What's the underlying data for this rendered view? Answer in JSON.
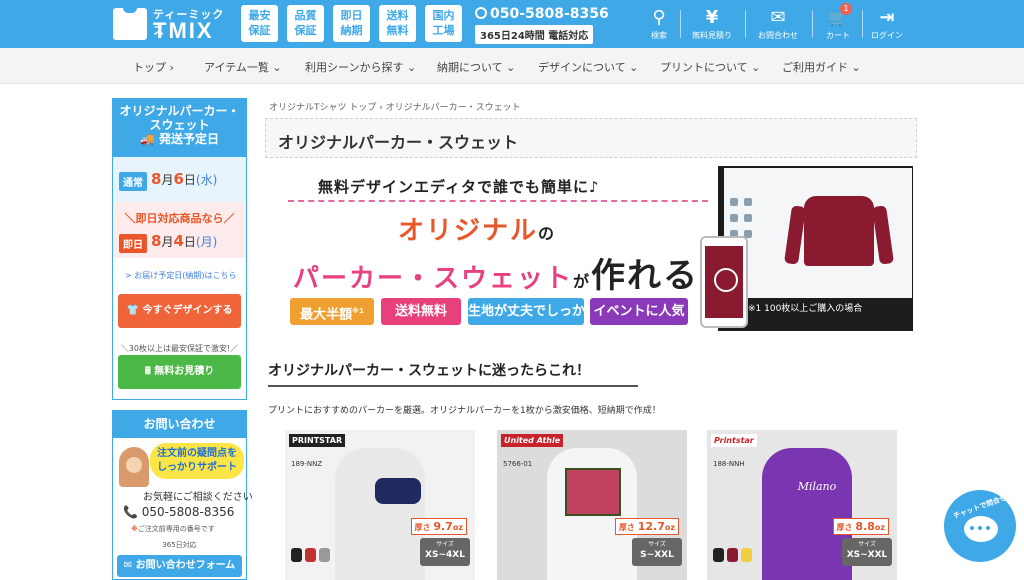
{
  "header": {
    "logo_kana": "ティーミックス",
    "logo_name": "TMIX",
    "features": [
      "最安\n保証",
      "品質\n保証",
      "即日\n納期",
      "送料\n無料",
      "国内\n工場"
    ],
    "phone": "050-5808-8356",
    "hours": "365日24時間 電話対応",
    "icons": [
      {
        "name": "search-icon",
        "glyph": "⚲",
        "label": "検索"
      },
      {
        "name": "yen-icon",
        "glyph": "¥",
        "label": "無料見積り"
      },
      {
        "name": "mail-icon",
        "glyph": "✉",
        "label": "お問合わせ"
      },
      {
        "name": "cart-icon",
        "glyph": "🛒",
        "label": "カート",
        "badge": "1"
      },
      {
        "name": "login-icon",
        "glyph": "⇥",
        "label": "ログイン"
      }
    ],
    "color": "#3fa9e8"
  },
  "nav": [
    "トップ ›",
    "アイテム一覧 ⌄",
    "利用シーンから探す ⌄",
    "納期について ⌄",
    "デザインについて ⌄",
    "プリントについて ⌄",
    "ご利用ガイド ⌄"
  ],
  "sidebar": {
    "ship_title": "オリジナルパーカー・スウェット",
    "ship_sub": "🚚 発送予定日",
    "normal_tag": "通常",
    "normal_month": "8",
    "normal_month_unit": "月",
    "normal_day": "6",
    "normal_day_unit": "日",
    "normal_wd": "(水)",
    "express_lead": "＼即日対応商品なら／",
    "express_tag": "即日",
    "express_month": "8",
    "express_month_unit": "月",
    "express_day": "4",
    "express_day_unit": "日",
    "express_wd": "(月)",
    "delivery_link": "> お届け予定日(納期)はこちら",
    "design_btn": "👕 今すぐデザインする",
    "cheap_note": "＼30枚以上は最安保証で激安!／",
    "estimate_btn": "🖩 無料お見積り",
    "contact_title": "お問い合わせ",
    "contact_bubble": "注文前の疑問点を\nしっかりサポート",
    "contact_ask": "お気軽にご相談ください",
    "contact_tel": "📞 050-5808-8356",
    "contact_note_mark": "※",
    "contact_note": "ご注文前専用の番号です",
    "contact_hours": "365日対応",
    "contact_form": "✉ お問い合わせフォーム"
  },
  "main": {
    "breadcrumb": "オリジナルTシャツ トップ  ›  オリジナルパーカー・スウェット",
    "title": "オリジナルパーカー・スウェット",
    "banner": {
      "top": "無料デザインエディタで誰でも簡単に♪",
      "big1": "オリジナル",
      "big1_suffix": "の",
      "big2": "パーカー・スウェット",
      "big2_suffix": "が",
      "big2_end": "作れる!!",
      "pills": [
        {
          "text": "最大半額",
          "sup": "※1",
          "color": "#f0a030"
        },
        {
          "text": "送料無料",
          "sup": "",
          "color": "#e8407a"
        },
        {
          "text": "生地が丈夫でしっかり",
          "sup": "",
          "color": "#3fa9e8"
        },
        {
          "text": "イベントに人気",
          "sup": "",
          "color": "#8a3ab8"
        }
      ],
      "caption": "※1 100枚以上ご購入の場合"
    },
    "section_title": "オリジナルパーカー・スウェットに迷ったらこれ！",
    "section_desc": "プリントにおすすめのパーカーを厳選。オリジナルパーカーを1枚から激安価格、短納期で作成！",
    "products": [
      {
        "brand": "PRINTSTAR",
        "brand_color": "#222",
        "sku": "189-NNZ",
        "thick_label": "厚さ",
        "thick": "9.7",
        "thick_unit": "oz",
        "size_label": "サイズ",
        "size": "XS~4XL"
      },
      {
        "brand": "United Athle",
        "brand_color": "#c8232a",
        "sku": "5766-01",
        "thick_label": "厚さ",
        "thick": "12.7",
        "thick_unit": "oz",
        "size_label": "サイズ",
        "size": "S~XXL"
      },
      {
        "brand": "Printstar",
        "brand_color": "#c8232a",
        "sku": "188-NNH",
        "thick_label": "厚さ",
        "thick": "8.8",
        "thick_unit": "oz",
        "size_label": "サイズ",
        "size": "XS~XXL",
        "print": "Milano"
      }
    ]
  },
  "chat": {
    "label": "チャットで問合せ"
  }
}
